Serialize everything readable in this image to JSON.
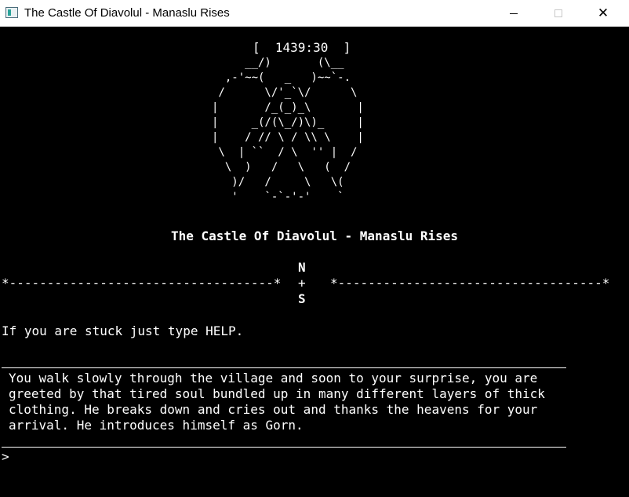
{
  "window": {
    "title": "The Castle Of Diavolul - Manaslu Rises",
    "controls": {
      "minimize": "─",
      "maximize": "□",
      "close": "✕"
    }
  },
  "console": {
    "timer": "[  1439:30  ]",
    "art_lines": [
      "     __/)       (\\__",
      "  ,-'~~(   _   )~~`-.",
      " /      \\/'_`\\/      \\",
      "|       /_(_)_\\       |",
      "|     _(/(\\_/)\\)_     |",
      "|    / // \\ / \\\\ \\    |",
      " \\  | ``  / \\  '' |  /",
      "  \\  )   /   \\   (  /",
      "   )/   /     \\   \\(",
      "   '    `-`-'-'    `"
    ],
    "game_title": "The Castle Of Diavolul - Manaslu Rises",
    "compass": {
      "north": "N",
      "south": "S",
      "center": "+"
    },
    "rule_left": "*-----------------------------------*",
    "rule_right": "*-----------------------------------*",
    "hint": "If you are stuck just type HELP.",
    "narration": [
      "You walk slowly through the village and soon to your surprise, you are",
      "greeted by that tired soul bundled up in many different layers of thick",
      "clothing. He breaks down and cries out and thanks the heavens for your",
      "arrival. He introduces himself as Gorn."
    ],
    "prompt": ">"
  }
}
